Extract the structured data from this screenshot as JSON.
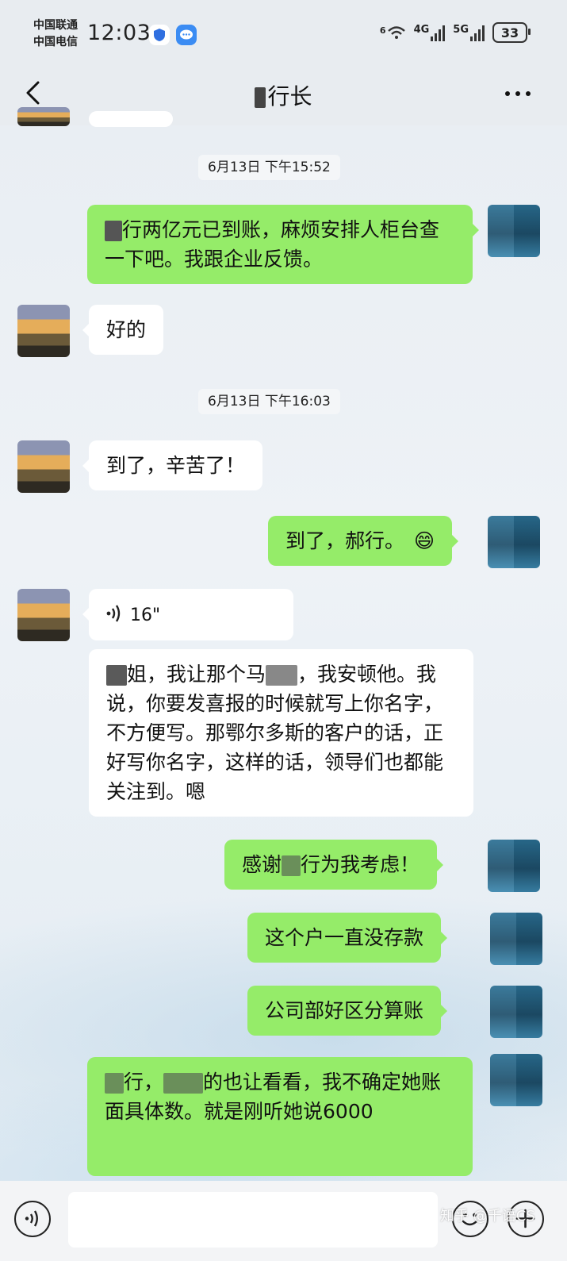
{
  "status_bar": {
    "carrier1": "中国联通",
    "carrier2": "中国电信",
    "time": "12:03",
    "wifi_label": "6",
    "network1": "4G",
    "network2": "5G",
    "battery": "33"
  },
  "header": {
    "title": "行长",
    "back_icon": "chevron-left-icon",
    "more_icon": "more-dots-icon"
  },
  "messages": {
    "ts1": "6月13日 下午15:52",
    "m1": "行两亿元已到账，麻烦安排人柜台查一下吧。我跟企业反馈。",
    "m2": "好的",
    "ts2": "6月13日 下午16:03",
    "m3": "到了，辛苦了！",
    "m4": "到了，郝行。",
    "m4_emoji": "😄",
    "m5_duration": "16\"",
    "m6_a": "姐，我让那个马",
    "m6_b": "，我安顿他。我说，你要发喜报的时候就写上你名字，不方便写。那鄂尔多斯的客户的话，正好写你名字，这样的话，领导们也都能关注到。嗯",
    "m7_a": "感谢",
    "m7_b": "行为我考虑！",
    "m8": "这个户一直没存款",
    "m9": "公司部好区分算账",
    "m10_a": "行，",
    "m10_b": "的也让看看，我不确定她账面具体数。就是刚听她说6000"
  },
  "input_bar": {
    "placeholder": "",
    "voice_icon": "voice-icon",
    "emoji_icon": "emoji-icon",
    "plus_icon": "plus-icon"
  },
  "watermark": "知乎 @千语CS"
}
